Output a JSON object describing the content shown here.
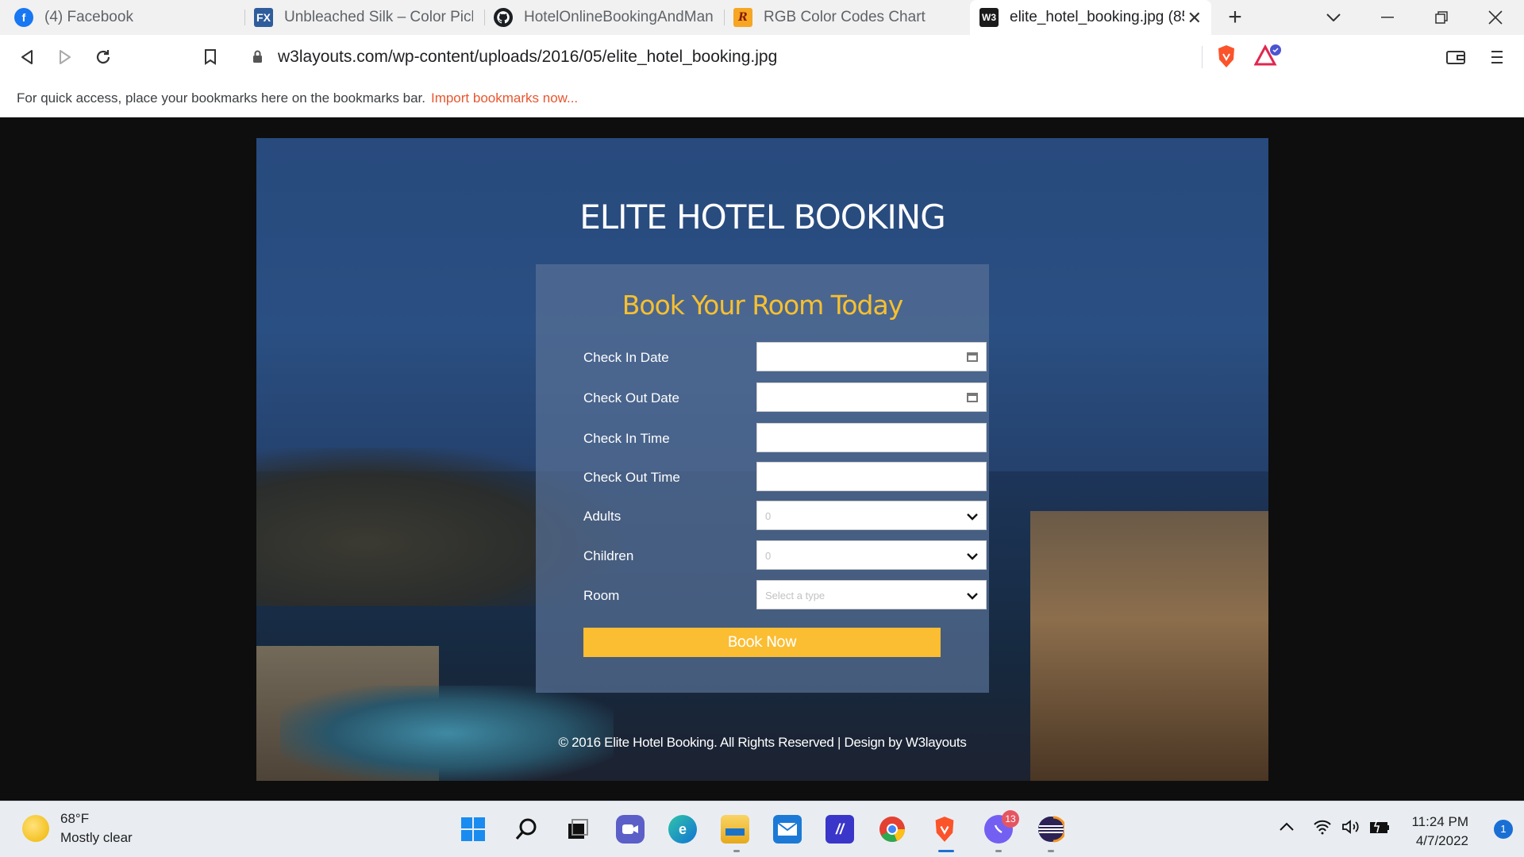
{
  "browser": {
    "tabs": [
      {
        "title": "(4) Facebook",
        "icon": "facebook-icon",
        "active": false
      },
      {
        "title": "Unbleached Silk – Color Picker |",
        "icon": "fx-icon",
        "active": false
      },
      {
        "title": "HotelOnlineBookingAndManag",
        "icon": "github-icon",
        "active": false
      },
      {
        "title": "RGB Color Codes Chart",
        "icon": "rapidtables-icon",
        "active": false
      },
      {
        "title": "elite_hotel_booking.jpg (85",
        "icon": "w3layouts-icon",
        "active": true
      }
    ],
    "new_tab": "+",
    "url": "w3layouts.com/wp-content/uploads/2016/05/elite_hotel_booking.jpg",
    "bookmarks_bar": {
      "message": "For quick access, place your bookmarks here on the bookmarks bar.",
      "link": "Import bookmarks now..."
    }
  },
  "page": {
    "title": "ELITE HOTEL BOOKING",
    "form": {
      "heading": "Book Your Room Today",
      "fields": [
        {
          "label": "Check In Date",
          "type": "date",
          "value": ""
        },
        {
          "label": "Check Out Date",
          "type": "date",
          "value": ""
        },
        {
          "label": "Check In Time",
          "type": "text",
          "value": ""
        },
        {
          "label": "Check Out Time",
          "type": "text",
          "value": ""
        },
        {
          "label": "Adults",
          "type": "select",
          "value": "0"
        },
        {
          "label": "Children",
          "type": "select",
          "value": "0"
        },
        {
          "label": "Room",
          "type": "select",
          "value": "Select a type"
        }
      ],
      "submit": "Book Now"
    },
    "footer": "© 2016 Elite Hotel Booking. All Rights Reserved | Design by W3layouts"
  },
  "taskbar": {
    "weather": {
      "temp": "68°F",
      "condition": "Mostly clear"
    },
    "clock": {
      "time": "11:24 PM",
      "date": "4/7/2022"
    },
    "notification_count": "1",
    "viber_badge": "13"
  },
  "colors": {
    "accent": "#fbbd31",
    "heading": "#f7c02f",
    "import_link": "#e8562f",
    "panel": "#587096"
  }
}
